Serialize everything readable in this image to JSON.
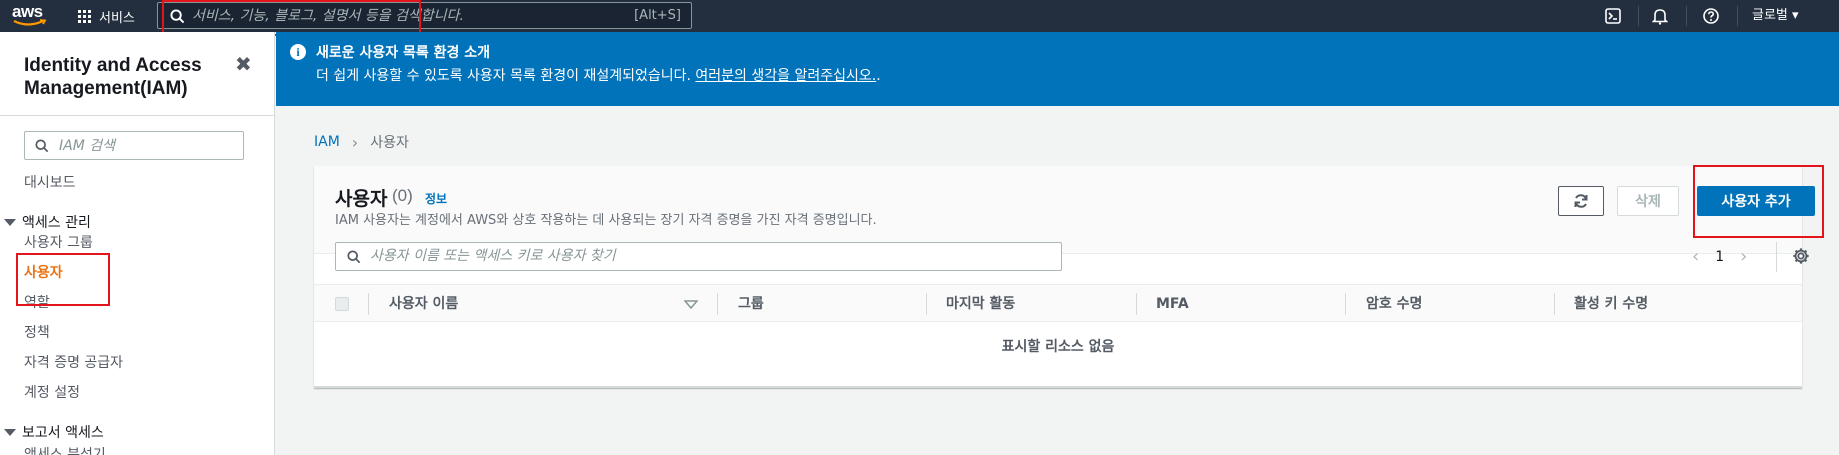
{
  "topnav": {
    "logo_text": "aws",
    "services_label": "서비스",
    "search_placeholder": "서비스, 기능, 블로그, 설명서 등을 검색합니다.",
    "search_shortcut": "[Alt+S]",
    "region_label": "글로벌 ▾",
    "icons": [
      "cloudshell-icon",
      "bell-icon",
      "help-icon"
    ]
  },
  "sidebar": {
    "title": "Identity and Access Management(IAM)",
    "search_placeholder": "IAM 검색",
    "dashboard": "대시보드",
    "access_management": {
      "label": "액세스 관리",
      "items": [
        {
          "label": "사용자 그룹",
          "active": false
        },
        {
          "label": "사용자",
          "active": true
        },
        {
          "label": "역할",
          "active": false
        },
        {
          "label": "정책",
          "active": false
        },
        {
          "label": "자격 증명 공급자",
          "active": false
        },
        {
          "label": "계정 설정",
          "active": false
        }
      ]
    },
    "report_access": {
      "label": "보고서 액세스",
      "items": [
        {
          "label": "액세스 분석기"
        }
      ]
    }
  },
  "banner": {
    "title": "새로운 사용자 목록 환경 소개",
    "text": "더 쉽게 사용할 수 있도록 사용자 목록 환경이 재설계되었습니다.",
    "link": "여러분의 생각을 알려주십시오.",
    "trailing": "."
  },
  "breadcrumb": {
    "root": "IAM",
    "current": "사용자"
  },
  "users_panel": {
    "title": "사용자",
    "count": "(0)",
    "info_link": "정보",
    "description": "IAM 사용자는 계정에서 AWS와 상호 작용하는 데 사용되는 장기 자격 증명을 가진 자격 증명입니다.",
    "delete_button": "삭제",
    "add_button": "사용자 추가",
    "search_placeholder": "사용자 이름 또는 액세스 키로 사용자 찾기",
    "page": "1",
    "columns": [
      "사용자 이름",
      "그룹",
      "마지막 활동",
      "MFA",
      "암호 수명",
      "활성 키 수명"
    ],
    "empty_text": "표시할 리소스 없음"
  },
  "colors": {
    "nav_bg": "#232f3e",
    "banner_bg": "#0073bb",
    "primary": "#0073bb",
    "active_link": "#ec7211",
    "highlight": "#e3141b"
  }
}
